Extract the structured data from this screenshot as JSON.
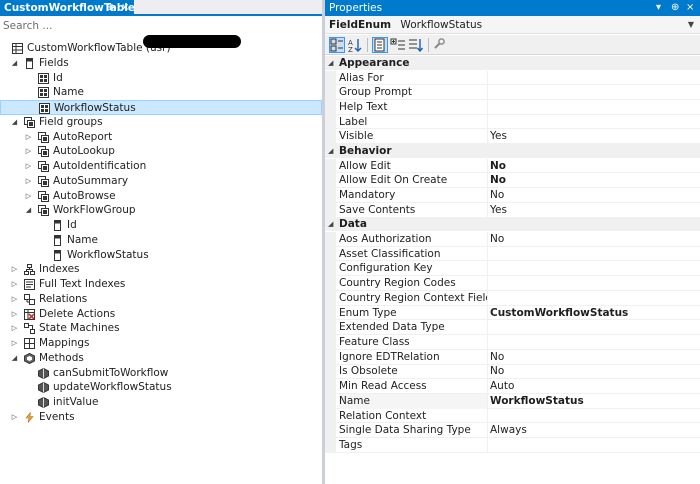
{
  "left": {
    "tab_title": "CustomWorkflowTable",
    "tab_pin": "⊕",
    "tab_close": "×",
    "search_placeholder": "Search ..."
  },
  "tree": [
    {
      "name": "tree-root-table",
      "label": "CustomWorkflowTable (usr)",
      "icon": "table",
      "level": 0,
      "expander": "",
      "selected": false
    },
    {
      "name": "tree-fields",
      "label": "Fields",
      "icon": "fields",
      "level": 1,
      "expander": "open",
      "selected": false
    },
    {
      "name": "tree-field-id",
      "label": "Id",
      "icon": "field",
      "level": 2,
      "expander": "",
      "selected": false
    },
    {
      "name": "tree-field-name",
      "label": "Name",
      "icon": "field",
      "level": 2,
      "expander": "",
      "selected": false
    },
    {
      "name": "tree-field-workflowstatus",
      "label": "WorkflowStatus",
      "icon": "field-enum",
      "level": 2,
      "expander": "",
      "selected": true
    },
    {
      "name": "tree-field-groups",
      "label": "Field groups",
      "icon": "fieldgroups",
      "level": 1,
      "expander": "open",
      "selected": false
    },
    {
      "name": "tree-group-autoreport",
      "label": "AutoReport",
      "icon": "group",
      "level": 2,
      "expander": "closed",
      "selected": false
    },
    {
      "name": "tree-group-autolookup",
      "label": "AutoLookup",
      "icon": "group",
      "level": 2,
      "expander": "closed",
      "selected": false
    },
    {
      "name": "tree-group-autoidentification",
      "label": "AutoIdentification",
      "icon": "group",
      "level": 2,
      "expander": "closed",
      "selected": false
    },
    {
      "name": "tree-group-autosummary",
      "label": "AutoSummary",
      "icon": "group",
      "level": 2,
      "expander": "closed",
      "selected": false
    },
    {
      "name": "tree-group-autobrowse",
      "label": "AutoBrowse",
      "icon": "group",
      "level": 2,
      "expander": "closed",
      "selected": false
    },
    {
      "name": "tree-group-workflowgroup",
      "label": "WorkFlowGroup",
      "icon": "group",
      "level": 2,
      "expander": "open",
      "selected": false
    },
    {
      "name": "tree-groupfield-id",
      "label": "Id",
      "icon": "groupfield",
      "level": 3,
      "expander": "",
      "selected": false
    },
    {
      "name": "tree-groupfield-name",
      "label": "Name",
      "icon": "groupfield",
      "level": 3,
      "expander": "",
      "selected": false
    },
    {
      "name": "tree-groupfield-workflowstatus",
      "label": "WorkflowStatus",
      "icon": "groupfield",
      "level": 3,
      "expander": "",
      "selected": false
    },
    {
      "name": "tree-indexes",
      "label": "Indexes",
      "icon": "indexes",
      "level": 1,
      "expander": "closed",
      "selected": false
    },
    {
      "name": "tree-fulltext-indexes",
      "label": "Full Text Indexes",
      "icon": "fulltext",
      "level": 1,
      "expander": "closed",
      "selected": false
    },
    {
      "name": "tree-relations",
      "label": "Relations",
      "icon": "relations",
      "level": 1,
      "expander": "closed",
      "selected": false
    },
    {
      "name": "tree-delete-actions",
      "label": "Delete Actions",
      "icon": "delete-actions",
      "level": 1,
      "expander": "closed",
      "selected": false
    },
    {
      "name": "tree-state-machines",
      "label": "State Machines",
      "icon": "state-machines",
      "level": 1,
      "expander": "closed",
      "selected": false
    },
    {
      "name": "tree-mappings",
      "label": "Mappings",
      "icon": "mappings",
      "level": 1,
      "expander": "closed",
      "selected": false
    },
    {
      "name": "tree-methods",
      "label": "Methods",
      "icon": "methods",
      "level": 1,
      "expander": "open",
      "selected": false
    },
    {
      "name": "tree-method-cansubmittoworkflow",
      "label": "canSubmitToWorkflow",
      "icon": "method",
      "level": 2,
      "expander": "",
      "selected": false
    },
    {
      "name": "tree-method-updateworkflowstatus",
      "label": "updateWorkflowStatus",
      "icon": "method",
      "level": 2,
      "expander": "",
      "selected": false
    },
    {
      "name": "tree-method-initvalue",
      "label": "initValue",
      "icon": "method",
      "level": 2,
      "expander": "",
      "selected": false
    },
    {
      "name": "tree-events",
      "label": "Events",
      "icon": "events",
      "level": 1,
      "expander": "closed",
      "selected": false
    }
  ],
  "properties": {
    "title": "Properties",
    "title_glyphs": [
      "▾",
      "⊕",
      "×"
    ],
    "selected_type": "FieldEnum",
    "selected_name": "WorkflowStatus",
    "categories": [
      {
        "name": "Appearance",
        "rows": [
          {
            "name": "Alias For",
            "value": "",
            "bold": false
          },
          {
            "name": "Group Prompt",
            "value": "",
            "bold": false
          },
          {
            "name": "Help Text",
            "value": "",
            "bold": false
          },
          {
            "name": "Label",
            "value": "",
            "bold": false
          },
          {
            "name": "Visible",
            "value": "Yes",
            "bold": false
          }
        ]
      },
      {
        "name": "Behavior",
        "rows": [
          {
            "name": "Allow Edit",
            "value": "No",
            "bold": true
          },
          {
            "name": "Allow Edit On Create",
            "value": "No",
            "bold": true
          },
          {
            "name": "Mandatory",
            "value": "No",
            "bold": false
          },
          {
            "name": "Save Contents",
            "value": "Yes",
            "bold": false
          }
        ]
      },
      {
        "name": "Data",
        "rows": [
          {
            "name": "Aos Authorization",
            "value": "No",
            "bold": false
          },
          {
            "name": "Asset Classification",
            "value": "",
            "bold": false
          },
          {
            "name": "Configuration Key",
            "value": "",
            "bold": false
          },
          {
            "name": "Country Region Codes",
            "value": "",
            "bold": false
          },
          {
            "name": "Country Region Context Field",
            "value": "",
            "bold": false
          },
          {
            "name": "Enum Type",
            "value": "CustomWorkflowStatus",
            "bold": true
          },
          {
            "name": "Extended Data Type",
            "value": "",
            "bold": false
          },
          {
            "name": "Feature Class",
            "value": "",
            "bold": false
          },
          {
            "name": "Ignore EDTRelation",
            "value": "No",
            "bold": false
          },
          {
            "name": "Is Obsolete",
            "value": "No",
            "bold": false
          },
          {
            "name": "Min Read Access",
            "value": "Auto",
            "bold": false
          },
          {
            "name": "Name",
            "value": "WorkflowStatus",
            "bold": true
          },
          {
            "name": "Relation Context",
            "value": "",
            "bold": false
          },
          {
            "name": "Single Data Sharing Type",
            "value": "Always",
            "bold": false
          },
          {
            "name": "Tags",
            "value": "",
            "bold": false
          }
        ]
      }
    ]
  },
  "colors": {
    "accent": "#007acc",
    "selection": "#cce8ff",
    "category_bg": "#f0f0f0"
  }
}
